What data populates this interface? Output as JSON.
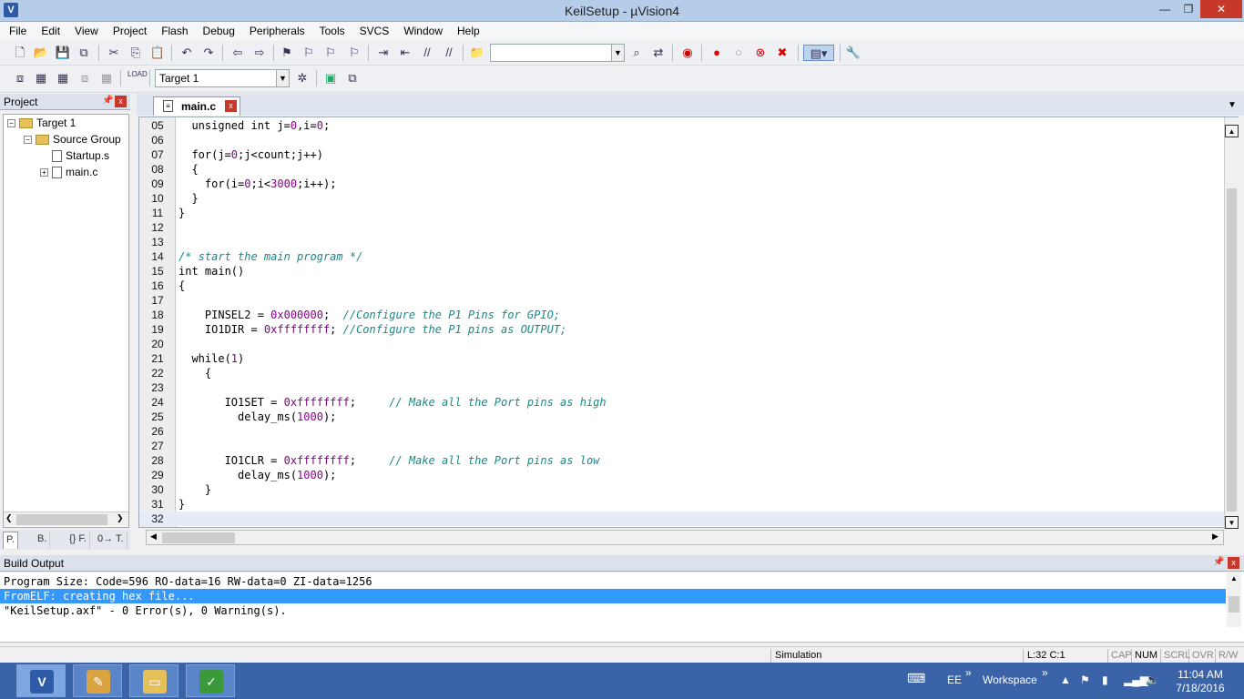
{
  "window": {
    "title": "KeilSetup  - µVision4",
    "app_icon": "V"
  },
  "menu": [
    "File",
    "Edit",
    "View",
    "Project",
    "Flash",
    "Debug",
    "Peripherals",
    "Tools",
    "SVCS",
    "Window",
    "Help"
  ],
  "toolbar2": {
    "target": "Target 1"
  },
  "project": {
    "title": "Project",
    "tree": [
      {
        "label": "Target 1",
        "type": "folder",
        "level": 0,
        "expander": "−"
      },
      {
        "label": "Source Group",
        "type": "folder",
        "level": 1,
        "expander": "−"
      },
      {
        "label": "Startup.s",
        "type": "file",
        "level": 2,
        "expander": ""
      },
      {
        "label": "main.c",
        "type": "file",
        "level": 2,
        "expander": "+"
      }
    ],
    "tabs": [
      "P.",
      "B.",
      "{} F.",
      "0→ T."
    ]
  },
  "editor": {
    "tab": "main.c",
    "current_line": "32",
    "lines": [
      {
        "n": "05",
        "parts": [
          [
            "kw",
            "  unsigned int j="
          ],
          [
            "num",
            "0"
          ],
          [
            "kw",
            ",i="
          ],
          [
            "num",
            "0"
          ],
          [
            "kw",
            ";"
          ]
        ]
      },
      {
        "n": "06",
        "parts": []
      },
      {
        "n": "07",
        "parts": [
          [
            "kw",
            "  for(j="
          ],
          [
            "num",
            "0"
          ],
          [
            "kw",
            ";j<count;j++)"
          ]
        ]
      },
      {
        "n": "08",
        "parts": [
          [
            "kw",
            "  {"
          ]
        ]
      },
      {
        "n": "09",
        "parts": [
          [
            "kw",
            "    for(i="
          ],
          [
            "num",
            "0"
          ],
          [
            "kw",
            ";i<"
          ],
          [
            "num",
            "3000"
          ],
          [
            "kw",
            ";i++);"
          ]
        ]
      },
      {
        "n": "10",
        "parts": [
          [
            "kw",
            "  }"
          ]
        ]
      },
      {
        "n": "11",
        "parts": [
          [
            "kw",
            "}"
          ]
        ]
      },
      {
        "n": "12",
        "parts": []
      },
      {
        "n": "13",
        "parts": []
      },
      {
        "n": "14",
        "parts": [
          [
            "cm",
            "/* start the main program */"
          ]
        ]
      },
      {
        "n": "15",
        "parts": [
          [
            "kw",
            "int main()"
          ]
        ]
      },
      {
        "n": "16",
        "parts": [
          [
            "kw",
            "{"
          ]
        ]
      },
      {
        "n": "17",
        "parts": []
      },
      {
        "n": "18",
        "parts": [
          [
            "kw",
            "    PINSEL2 = "
          ],
          [
            "num",
            "0x000000"
          ],
          [
            "kw",
            ";  "
          ],
          [
            "cm",
            "//Configure the P1 Pins for GPIO;"
          ]
        ]
      },
      {
        "n": "19",
        "parts": [
          [
            "kw",
            "    IO1DIR = "
          ],
          [
            "num",
            "0xffffffff"
          ],
          [
            "kw",
            "; "
          ],
          [
            "cm",
            "//Configure the P1 pins as OUTPUT;"
          ]
        ]
      },
      {
        "n": "20",
        "parts": []
      },
      {
        "n": "21",
        "parts": [
          [
            "kw",
            "  while("
          ],
          [
            "num",
            "1"
          ],
          [
            "kw",
            ")"
          ]
        ]
      },
      {
        "n": "22",
        "parts": [
          [
            "kw",
            "    {"
          ]
        ]
      },
      {
        "n": "23",
        "parts": []
      },
      {
        "n": "24",
        "parts": [
          [
            "kw",
            "       IO1SET = "
          ],
          [
            "num",
            "0xffffffff"
          ],
          [
            "kw",
            ";     "
          ],
          [
            "cm",
            "// Make all the Port pins as high"
          ]
        ]
      },
      {
        "n": "25",
        "parts": [
          [
            "kw",
            "         delay_ms("
          ],
          [
            "num",
            "1000"
          ],
          [
            "kw",
            ");"
          ]
        ]
      },
      {
        "n": "26",
        "parts": []
      },
      {
        "n": "27",
        "parts": []
      },
      {
        "n": "28",
        "parts": [
          [
            "kw",
            "       IO1CLR = "
          ],
          [
            "num",
            "0xffffffff"
          ],
          [
            "kw",
            ";     "
          ],
          [
            "cm",
            "// Make all the Port pins as low"
          ]
        ]
      },
      {
        "n": "29",
        "parts": [
          [
            "kw",
            "         delay_ms("
          ],
          [
            "num",
            "1000"
          ],
          [
            "kw",
            ");"
          ]
        ]
      },
      {
        "n": "30",
        "parts": [
          [
            "kw",
            "    }"
          ]
        ]
      },
      {
        "n": "31",
        "parts": [
          [
            "kw",
            "}"
          ]
        ]
      },
      {
        "n": "32",
        "parts": []
      }
    ]
  },
  "build": {
    "title": "Build Output",
    "lines": [
      "Program Size: Code=596 RO-data=16 RW-data=0 ZI-data=1256",
      "FromELF: creating hex file...",
      "\"KeilSetup.axf\" - 0 Error(s), 0 Warning(s)."
    ],
    "selected_index": 1
  },
  "status": {
    "mode": "Simulation",
    "position": "L:32 C:1",
    "indicators": [
      "CAP",
      "NUM",
      "SCRL",
      "OVR",
      "R/W"
    ]
  },
  "taskbar": {
    "tray_lang": "EE",
    "workspace": "Workspace",
    "time": "11:04 AM",
    "date": "7/18/2016"
  }
}
